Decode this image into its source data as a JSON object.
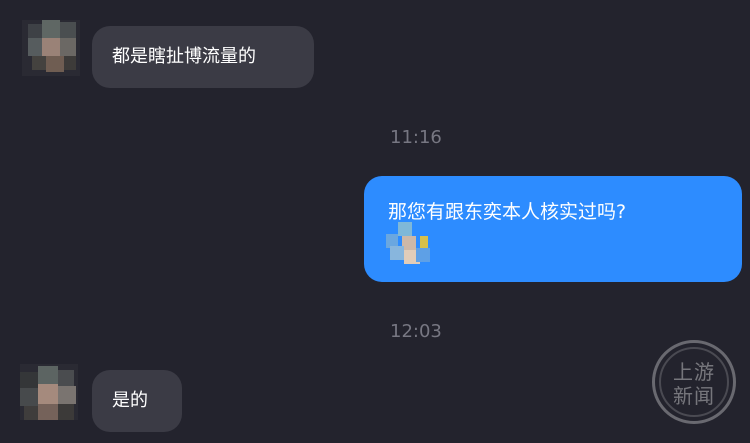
{
  "messages": [
    {
      "id": "m1",
      "direction": "incoming",
      "text": "都是瞎扯博流量的"
    },
    {
      "id": "t1",
      "type": "timestamp",
      "text": "11:16"
    },
    {
      "id": "m2",
      "direction": "outgoing",
      "text": "那您有跟东奕本人核实过吗?",
      "has_sticker": true
    },
    {
      "id": "t2",
      "type": "timestamp",
      "text": "12:03"
    },
    {
      "id": "m3",
      "direction": "incoming",
      "text": "是的"
    }
  ],
  "watermark": {
    "line1": "上游",
    "line2": "新闻"
  },
  "colors": {
    "background": "#23232d",
    "incoming_bubble": "#3b3b45",
    "outgoing_bubble": "#2d8cff",
    "timestamp": "#777782",
    "text": "#ffffff"
  },
  "icons": {
    "avatar": "pixelated-avatar-icon",
    "sticker": "sticker-icon",
    "watermark": "watermark-logo"
  }
}
